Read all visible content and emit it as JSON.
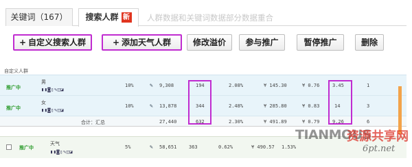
{
  "tabs": [
    {
      "label": "关键词（167）"
    },
    {
      "label": "搜索人群",
      "badge": "新"
    }
  ],
  "tab_note": "人群数据和关键词数据部分数据重合",
  "toolbar": {
    "custom_search_crowd": "自定义搜索人群",
    "add_weather_crowd": "添加天气人群",
    "modify_premium": "修改溢价",
    "join_promotion": "参与推广",
    "pause_promotion": "暂停推广",
    "delete": "删除",
    "plus_icon": "+"
  },
  "table": {
    "section_label": "自定义人群",
    "rows": [
      {
        "status": "推广中",
        "name": "男",
        "premium": "10%",
        "impressions": "9,308",
        "clicks": "194",
        "ctr": "2.08%",
        "cost": "¥ 145.30",
        "cpc": "¥ 0.76",
        "col_e": "3.45",
        "col_f": "1"
      },
      {
        "status": "推广中",
        "name": "女",
        "premium": "10%",
        "impressions": "13,878",
        "clicks": "344",
        "ctr": "2.48%",
        "cost": "¥ 285.80",
        "cpc": "¥ 0.83",
        "col_e": "14",
        "col_f": "3"
      }
    ],
    "summary": {
      "label": "合计：汇总",
      "impressions": "27,440",
      "clicks": "632",
      "ctr": "2.30%",
      "cost": "¥ 491.89",
      "cpc": "¥ 0.79",
      "col_e": "9.26",
      "col_f": "6"
    },
    "weather_row": {
      "status": "推广中",
      "name": "天气",
      "premium": "5%",
      "impressions": "58,651",
      "clicks": "363",
      "ctr": "0.62%",
      "cost": "¥ 490.57",
      "cpc": "1.53%"
    },
    "op_icons": "▮▮◙▯✎◫◪",
    "edit_icon": "✎"
  },
  "watermark": {
    "brand": "TIANMOUS",
    "cn": "资源共享网",
    "url": "6pt.net"
  },
  "colors": {
    "highlight": "#c02bd0",
    "status_green": "#2a9a2a",
    "new_badge": "#e0341f",
    "accent_orange": "#f3a34a"
  }
}
